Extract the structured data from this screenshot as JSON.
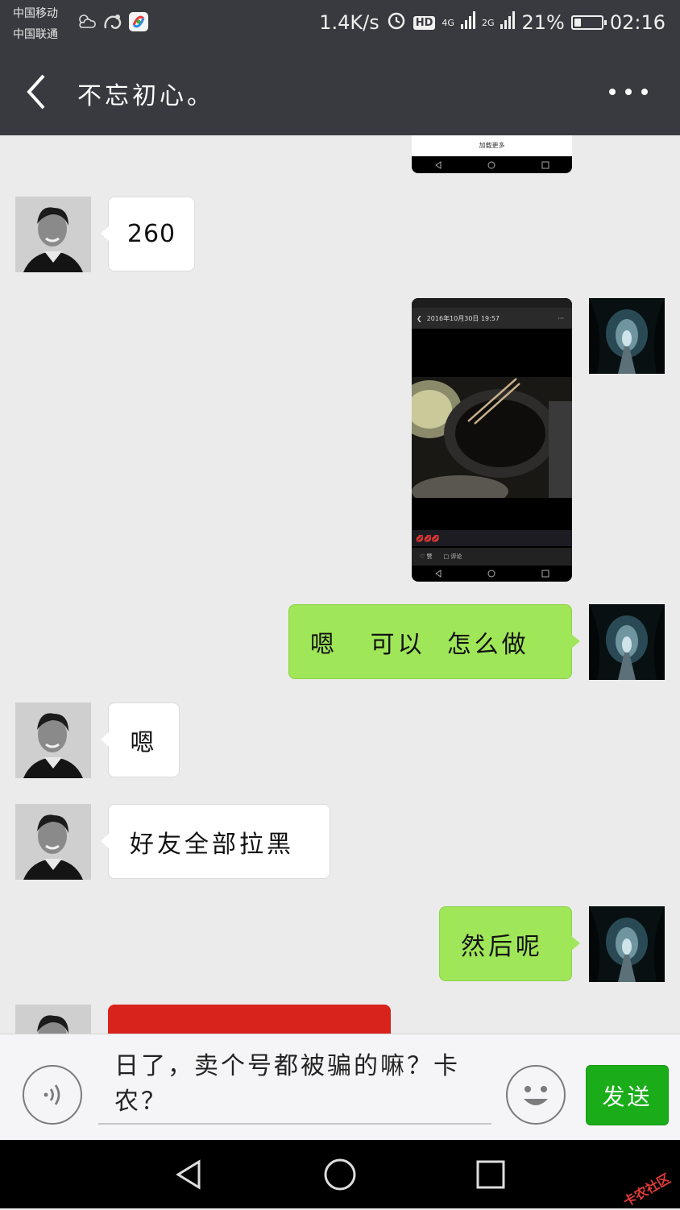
{
  "status_bar": {
    "carrier_1": "中国移动",
    "carrier_2": "中国联通",
    "net_speed": "1.4K/s",
    "hd_label": "HD",
    "net_4g": "4G",
    "net_2g": "2G",
    "battery": "21%",
    "time": "02:16"
  },
  "header": {
    "title": "不忘初心。",
    "back_icon": "chevron-left-icon",
    "more_icon": "more-dots-icon"
  },
  "messages": [
    {
      "side": "right",
      "type": "image",
      "caption": "加载更多"
    },
    {
      "side": "left",
      "type": "text",
      "text": "260"
    },
    {
      "side": "right",
      "type": "image",
      "screenshot_date": "2016年10月30日  19:57",
      "emoji": "💋💋💋",
      "like": "赞",
      "comment": "评论"
    },
    {
      "side": "right",
      "type": "text",
      "text": "嗯   可以  怎么做"
    },
    {
      "side": "left",
      "type": "text",
      "text": "嗯"
    },
    {
      "side": "left",
      "type": "text",
      "text": "好友全部拉黑"
    },
    {
      "side": "right",
      "type": "text",
      "text": "然后呢"
    },
    {
      "side": "left",
      "type": "red_packet",
      "color": "#d8231c"
    }
  ],
  "input_bar": {
    "voice_icon": "voice-wave-icon",
    "text": "日了，卖个号都被骗的嘛？卡农？",
    "emoji_icon": "smiley-icon",
    "send_label": "发送"
  },
  "colors": {
    "header_bg": "#393a3f",
    "chat_bg": "#ebebeb",
    "my_bubble": "#9fe658",
    "send_button": "#1aad19"
  },
  "nav_bar": {
    "back_icon": "triangle-back-icon",
    "home_icon": "circle-home-icon",
    "recent_icon": "square-recent-icon",
    "watermark": "卡农社区"
  }
}
